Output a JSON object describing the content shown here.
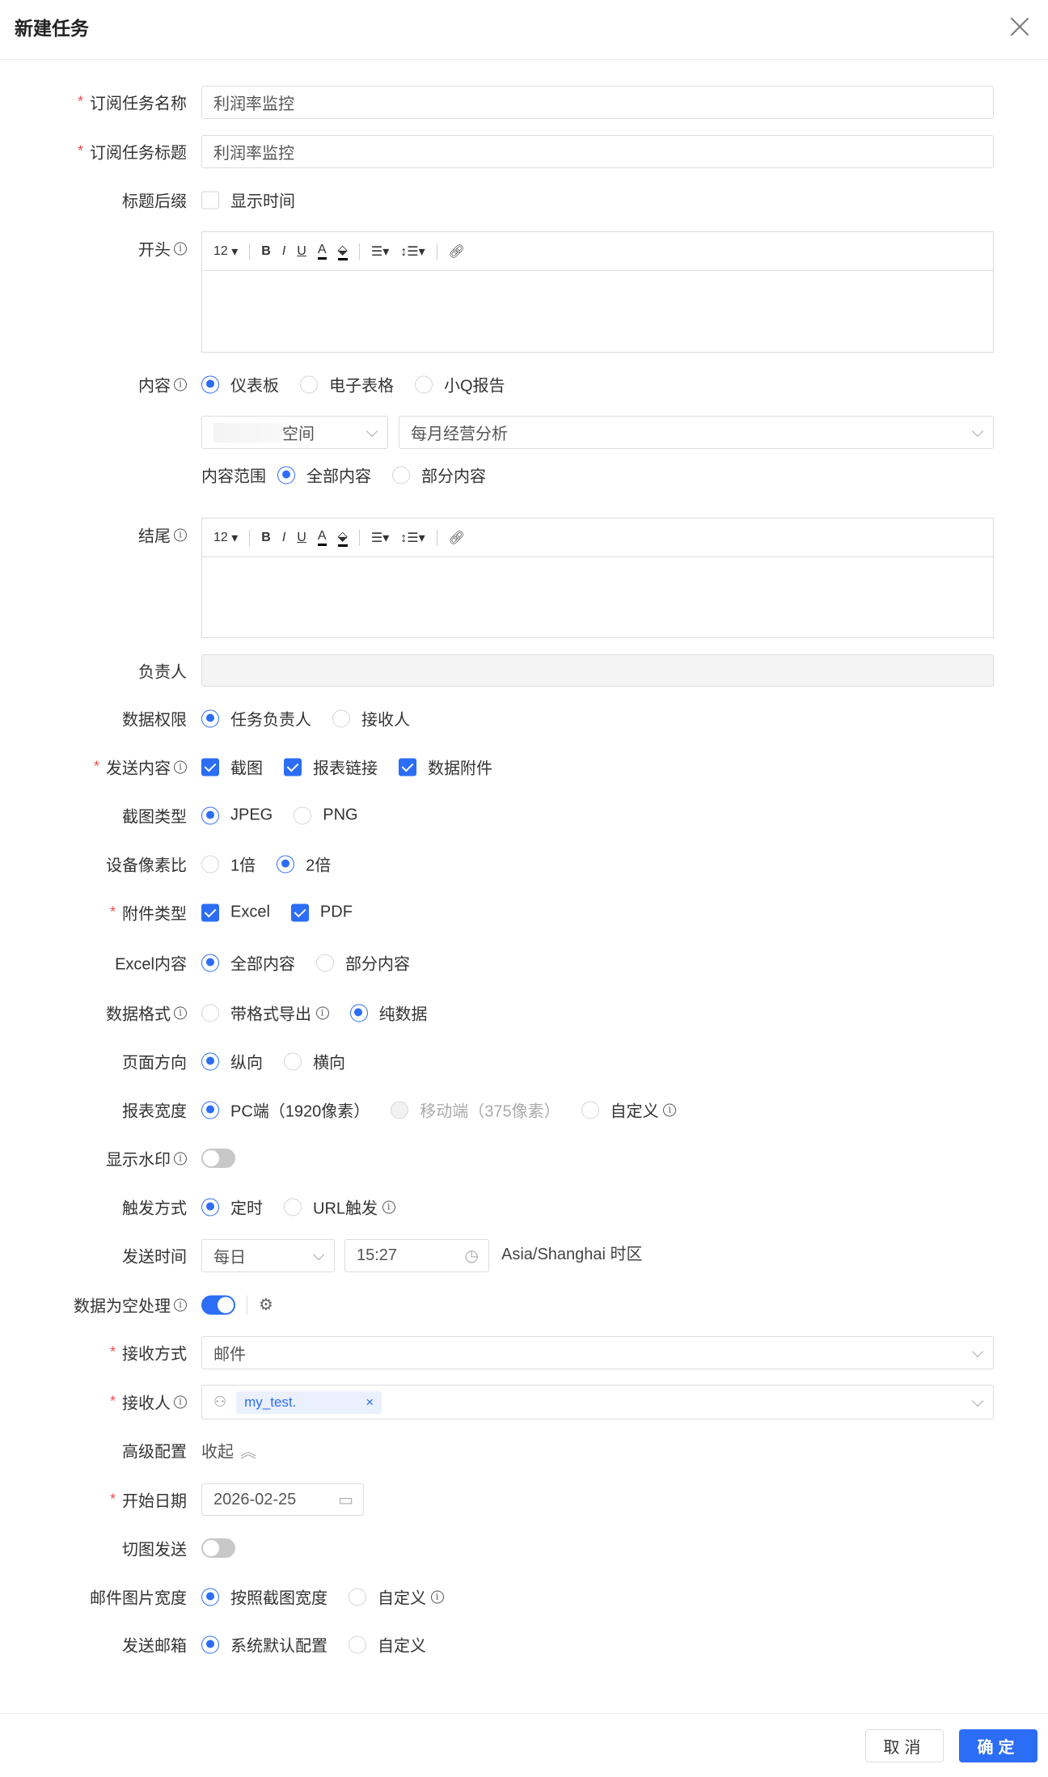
{
  "header": {
    "title": "新建任务"
  },
  "form": {
    "task_name": {
      "label": "订阅任务名称",
      "value": "利润率监控"
    },
    "task_title": {
      "label": "订阅任务标题",
      "value": "利润率监控"
    },
    "title_suffix": {
      "label": "标题后缀",
      "option": "显示时间"
    },
    "opening": {
      "label": "开头"
    },
    "closing": {
      "label": "结尾"
    },
    "toolbar": {
      "font_size": "12",
      "bold": "B",
      "italic": "I",
      "underline": "U",
      "font_color": "A"
    },
    "content": {
      "label": "内容",
      "options": [
        "仪表板",
        "电子表格",
        "小Q报告"
      ],
      "space_select": "空间",
      "report_select": "每月经营分析",
      "scope_label": "内容范围",
      "scope_options": [
        "全部内容",
        "部分内容"
      ]
    },
    "owner": {
      "label": "负责人"
    },
    "data_permission": {
      "label": "数据权限",
      "options": [
        "任务负责人",
        "接收人"
      ]
    },
    "send_content": {
      "label": "发送内容",
      "options": [
        "截图",
        "报表链接",
        "数据附件"
      ]
    },
    "screenshot_type": {
      "label": "截图类型",
      "options": [
        "JPEG",
        "PNG"
      ]
    },
    "pixel_ratio": {
      "label": "设备像素比",
      "options": [
        "1倍",
        "2倍"
      ]
    },
    "attachment_type": {
      "label": "附件类型",
      "options": [
        "Excel",
        "PDF"
      ]
    },
    "excel_content": {
      "label": "Excel内容",
      "options": [
        "全部内容",
        "部分内容"
      ]
    },
    "data_format": {
      "label": "数据格式",
      "options": [
        "带格式导出",
        "纯数据"
      ]
    },
    "orientation": {
      "label": "页面方向",
      "options": [
        "纵向",
        "横向"
      ]
    },
    "report_width": {
      "label": "报表宽度",
      "options": [
        "PC端（1920像素）",
        "移动端（375像素）",
        "自定义"
      ]
    },
    "watermark": {
      "label": "显示水印"
    },
    "trigger": {
      "label": "触发方式",
      "options": [
        "定时",
        "URL触发"
      ]
    },
    "send_time": {
      "label": "发送时间",
      "frequency": "每日",
      "time": "15:27",
      "timezone": "Asia/Shanghai 时区"
    },
    "empty_data": {
      "label": "数据为空处理"
    },
    "receive_method": {
      "label": "接收方式",
      "value": "邮件"
    },
    "receivers": {
      "label": "接收人",
      "tag": "my_test."
    },
    "advanced": {
      "label": "高级配置",
      "toggle": "收起"
    },
    "start_date": {
      "label": "开始日期",
      "value": "2026-02-25"
    },
    "split_send": {
      "label": "切图发送"
    },
    "mail_image_width": {
      "label": "邮件图片宽度",
      "options": [
        "按照截图宽度",
        "自定义"
      ]
    },
    "sender_mailbox": {
      "label": "发送邮箱",
      "options": [
        "系统默认配置",
        "自定义"
      ]
    }
  },
  "footer": {
    "cancel": "取消",
    "confirm": "确定"
  },
  "colors": {
    "primary": "#2c6df6",
    "required": "#f5484a"
  }
}
